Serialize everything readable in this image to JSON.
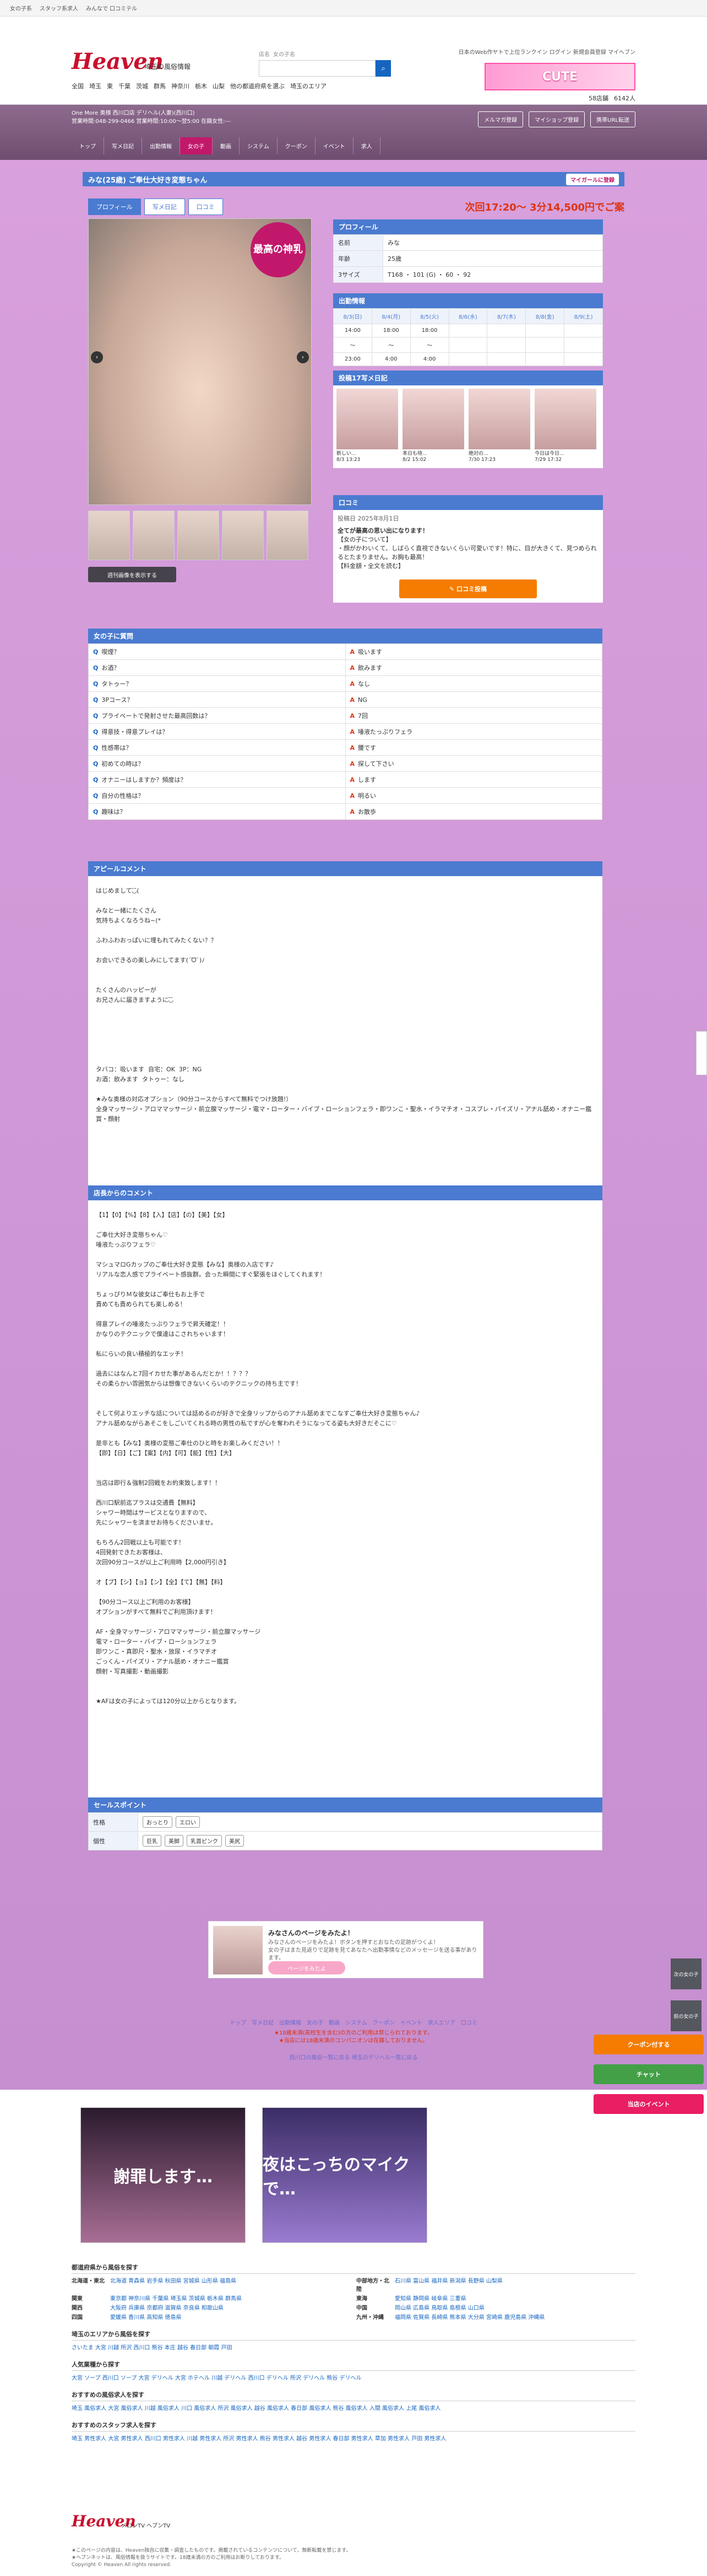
{
  "topbar": {
    "items": [
      "女の子系",
      "スタッフ系求人",
      "みんなで 口コミテル"
    ]
  },
  "header": {
    "logo": "Heaven",
    "logo_sub": "埼玉の風俗情報",
    "search_tabs": [
      "店名",
      "女の子名"
    ],
    "search_placeholder": "",
    "right_text": "日本のWeb作ヤトで上位ランクイン  ログイン  新規会員登録  マイヘブン",
    "regions": [
      "全国",
      "埼玉",
      "東",
      "千葉",
      "茨城",
      "群馬",
      "神奈川",
      "栃木",
      "山梨",
      "他の都道府県を選ぶ",
      "埼玉のエリア"
    ],
    "banner": "CUTE",
    "counts": [
      "58店舗",
      "6142人"
    ]
  },
  "shop": {
    "info_line1": "One More 奥様 西川口店 デリヘル(人妻)(西川口)",
    "info_line2": "営業時間:048-299-0466 営業時間:10:00〜翌5:00 在籍女性:---",
    "buttons": [
      "メルマガ登録",
      "マイショップ登録",
      "携帯URL転送"
    ],
    "nav": [
      "トップ",
      "写メ日記",
      "出勤情報",
      "女の子",
      "動画",
      "システム",
      "クーポン",
      "イベント",
      "求人"
    ]
  },
  "girl": {
    "name_bar": "みな(25歳)  ご奉仕大好き変態ちゃん",
    "my_girl_btn": "マイガールに登録",
    "tabs": [
      "プロフィール",
      "写メ日記",
      "口コミ"
    ],
    "schedule_now": "次回17:20〜 3分14,500円でご案",
    "badge": "最高の神乳",
    "zoom_btn": "週刊画像を表示する"
  },
  "profile": {
    "title": "プロフィール",
    "rows": [
      {
        "k": "名前",
        "v": "みな"
      },
      {
        "k": "年齢",
        "v": "25歳"
      },
      {
        "k": "3サイズ",
        "v": "T168 ・ 101 (G) ・ 60 ・ 92"
      }
    ]
  },
  "schedule": {
    "title": "出勤情報",
    "days": [
      "8/3(日)",
      "8/4(月)",
      "8/5(火)",
      "8/6(水)",
      "8/7(木)",
      "8/8(金)",
      "8/9(土)"
    ],
    "row1": [
      "14:00",
      "18:00",
      "18:00",
      "",
      "",
      "",
      ""
    ],
    "row2": [
      "〜",
      "〜",
      "〜",
      "",
      "",
      "",
      ""
    ],
    "row3": [
      "23:00",
      "4:00",
      "4:00",
      "",
      "",
      "",
      ""
    ]
  },
  "diary": {
    "title": "投稿17写メ日記",
    "cards": [
      {
        "t": "新しい...",
        "d": "8/3 13:23"
      },
      {
        "t": "本日も待...",
        "d": "8/2 15:02"
      },
      {
        "t": "絶対の...",
        "d": "7/30 17:23"
      },
      {
        "t": "今日は今日...",
        "d": "7/29 17:32"
      }
    ]
  },
  "review": {
    "title": "口コミ",
    "date": "投稿日  2025年8月1日",
    "headline": "全てが最高の思い出になります！",
    "body": "【女の子について】\n・顔がかわいくて、しばらく直視できないくらい可愛いです！特に、目が大きくて、見つめられるとたまりません。お胸も最高！\n【料金額・全文を読む】",
    "button": "口コミ投稿"
  },
  "qa": {
    "title": "女の子に質問",
    "rows": [
      [
        "喫煙？",
        "吸います",
        "お酒？",
        "飲みます"
      ],
      [
        "タトゥー？",
        "なし",
        "3Pコース？",
        "NG"
      ],
      [
        "プライベートで発射させた最高回数は？",
        "7回",
        "得意技・得意プレイは？",
        "唾液たっぷりフェラ"
      ],
      [
        "性感帯は？",
        "腰です",
        "初めての時は？",
        "探して下さい"
      ],
      [
        "オナニーはしますか？頻度は？",
        "します",
        "自分の性格は？",
        "明るい"
      ],
      [
        "趣味は？",
        "お散歩",
        "",
        ""
      ]
    ]
  },
  "appeal": {
    "title": "アピールコメント",
    "text": "はじめまして◟̆◞̆(\n\nみなと一緒にたくさん\n気持ちよくなろうね~(*\n\nふわふわおっぱいに埋もれてみたくない？？\n\nお会いできるの楽しみにしてます(ˊᗜˋ)ﾉ\n\n\nたくさんのハッピーが\nお兄さんに届きますように◟̆◞̆\n\n\n\n\n\n\nタバコ：吸います  自宅：OK  3P：NG\nお酒：飲みます  タトゥー：なし\n\n★みな奥様の対応オプション（90分コースからすべて無料でつけ放題!）\n全身マッサージ・アロママッサージ・前立腺マッサージ・電マ・ローター・バイブ・ローションフェラ・即ワンこ・聖水・イラマチオ・コスプレ・パイズリ・アナル舐め・オナニー鑑賞・顔射"
  },
  "shopcomment": {
    "title": "店長からのコメント",
    "text": "【1】【0】【%】【8】【入】【店】【の】【美】【女】\n\nご奉仕大好き変態ちゃん♡\n唾液たっぷりフェラ♡\n\nマシュマロGカップのご奉仕大好き変態【みな】奥様の入店です♪\nリアルな恋人感でプライベート感抜群。会った瞬間にすぐ緊張をほぐしてくれます！\n\nちょっぴりＭな彼女はご奉仕もお上手で\n責めても責められても楽しめる！\n\n得意プレイの唾液たっぷりフェラで昇天確定！！\nかなりのテクニックで僕達はこされちゃいます！\n\n私にらいの良い積極的なエッチ！\n\n過去にはなんと7回イカせた事があるんだとか！！？？？\nその柔らかい雰囲気からは想像できないくらいのテクニックの持ち主です！\n\n\nそして何よりエッチな話については話めるのが好きで全身リップからのアナル舐めまでこなすご奉仕大好き変態ちゃん♪\nアナル舐めながらあそこをしごいてくれる時の男性の私ですが心を奪われそうになってる姿も大好きだそこに♡\n\n是非とも【みな】奥様の変態ご奉仕のひと時をお楽しみください！！\n【即】【日】【ご】【案】【内】【可】【能】【性】【大】\n\n\n当店は即行＆強制2回戦をお約束致します！！\n\n西川口駅前迄プラスは交通費【無料】\nシャワー時間はサービスとなりますので、\n先にシャワーを済ませお待ちくださいませ。\n\nもちろん2回戦以上も可能です！\n4回発射できたお客様は、\n次回90分コースが以上ご利用時【2,000円引き】\n\nオ【プ】【シ】【ョ】【ン】【全】【て】【無】【料】\n\n【90分コース以上ご利用のお客様】\nオプションがすべて無料でご利用頂けます！\n\nAF・全身マッサージ・アロママッサージ・前立腺マッサージ\n電マ・ローター・バイブ・ローションフェラ\n即ワンこ・真即尺・聖水・放尿・イラマチオ\nごっくん・パイズリ・アナル舐め・オナニー鑑賞\n顔射・写真撮影・動画撮影\n\n\n★AFは女の子によっては120分以上からとなります。"
  },
  "sales": {
    "title": "セールスポイント",
    "rows": [
      {
        "k": "性格",
        "tags": [
          "おっとり",
          "エロい"
        ]
      },
      {
        "k": "個性",
        "tags": [
          "巨乳",
          "美脚",
          "乳首ピンク",
          "美尻"
        ]
      }
    ]
  },
  "like": {
    "title": "みなさんのページをみたよ！",
    "sub": "みなさんのページをみたよ！ボタンを押すとおなたの足跡がつくよ！\n女の子はまた見返りで足跡を見てあなたへ出勤事情などのメッセージを送る事があります。",
    "button": "ページをみたよ"
  },
  "footnav": {
    "links": [
      "トップ",
      "写メ日記",
      "出勤情報",
      "女の子",
      "動画",
      "システム",
      "クーポン",
      "イベント",
      "求人エリア",
      "口コミ"
    ],
    "note1": "★18歳未満(高校生を含む)の方のご利用は禁じられております。",
    "note2": "★当店には18歳未満のコンパニオンは在籍しておりません。",
    "related": "西川口の風俗一覧に戻る   埼玉のデリヘル一覧に戻る"
  },
  "side": {
    "next": "次の女の子",
    "prev": "前の女の子",
    "up": "上へ"
  },
  "floats": {
    "coupon": "クーポン付する",
    "chat": "チャット",
    "event": "当店のイベント"
  },
  "ads": {
    "ad1": "謝罪します…",
    "ad2": "夜はこっちのマイクで…"
  },
  "bottom": {
    "area_title": "都道府県から風俗を探す",
    "areas": [
      {
        "k": "北海道・東北",
        "v": "北海道  青森県  岩手県  秋田県  宮城県  山形県  福島県"
      },
      {
        "k": "中部地方・北陸",
        "v": "石川県  富山県  福井県  新潟県  長野県  山梨県"
      },
      {
        "k": "関東",
        "v": "東京都  神奈川県  千葉県  埼玉県  茨城県  栃木県  群馬県"
      },
      {
        "k": "東海",
        "v": "愛知県  静岡県  岐阜県  三重県"
      },
      {
        "k": "関西",
        "v": "大阪府  兵庫県  京都府  滋賀県  奈良県  和歌山県"
      },
      {
        "k": "中国",
        "v": "岡山県  広島県  鳥取県  島根県  山口県"
      },
      {
        "k": "四国",
        "v": "愛媛県  香川県  高知県  徳島県"
      },
      {
        "k": "九州・沖縄",
        "v": "福岡県  佐賀県  長崎県  熊本県  大分県  宮崎県  鹿児島県  沖縄県"
      }
    ],
    "popular_title": "埼玉のエリアから風俗を探す",
    "popular": "さいたま  大宮  川越  所沢  西川口  熊谷  本庄  越谷  春日部  朝霞  戸田",
    "genre_title": "人気業種から探す",
    "genre": "大宮 ソープ  西川口 ソープ  大宮 デリヘル  大宮 ホテヘル  川越 デリヘル  西川口 デリヘル  所沢 デリヘル  熊谷 デリヘル",
    "recommend_title": "おすすめの風俗求人を探す",
    "recommend": "埼玉 風俗求人  大宮 風俗求人  川越 風俗求人  川口 風俗求人  所沢 風俗求人  越谷 風俗求人  春日部 風俗求人  熊谷 風俗求人  入間 風俗求人  上尾 風俗求人",
    "staff_title": "おすすめのスタッフ求人を探す",
    "staff": "埼玉 男性求人  大宮 男性求人  西川口 男性求人  川越 男性求人  所沢 男性求人  熊谷 男性求人  越谷 男性求人  春日部 男性求人  草加 男性求人  戸田 男性求人",
    "foot_links": "メロンTV   ヘブンTV",
    "copyright": "★このページの内容は、Heaven独自に収集・調査したものです。掲載されているコンテンツについて、無断転載を禁じます。\n★ヘブンネットは、風俗情報を扱うサイトです。18歳未満の方のご利用はお断りしております。\nCopyright © Heaven All rights reserved."
  }
}
